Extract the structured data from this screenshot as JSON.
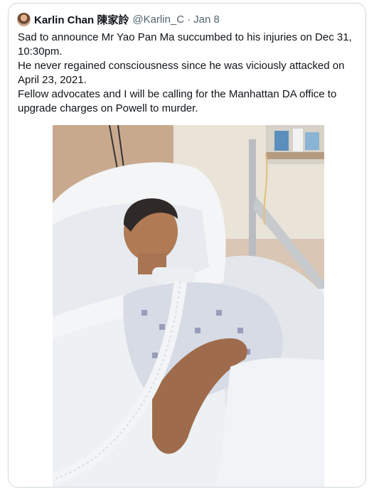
{
  "tweet": {
    "avatar_icon": "user-avatar-photo",
    "display_name": "Karlin Chan 陳家詅",
    "handle": "@Karlin_C",
    "separator": "·",
    "date": "Jan 8",
    "text_lines": [
      "Sad to announce Mr Yao Pan Ma succumbed to his injuries on Dec 31, 10:30pm.",
      "He never regained consciousness since he was viciously attacked on April 23, 2021.",
      "Fellow advocates and I will be calling for the Manhattan DA office to upgrade charges on Powell to murder."
    ],
    "image_icon": "hospital-bed-photo"
  }
}
